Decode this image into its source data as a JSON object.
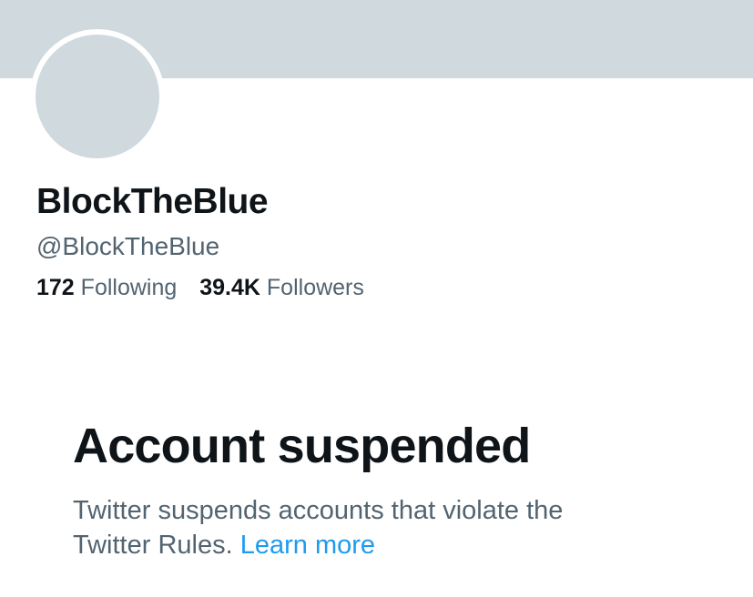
{
  "profile": {
    "display_name": "BlockTheBlue",
    "handle": "@BlockTheBlue",
    "following_count": "172",
    "following_label": "Following",
    "followers_count": "39.4K",
    "followers_label": "Followers"
  },
  "suspension": {
    "title": "Account suspended",
    "description_line1": "Twitter suspends accounts that violate the",
    "description_line2": "Twitter Rules.",
    "learn_more_label": "Learn more"
  },
  "colors": {
    "banner": "#cfd9de",
    "avatar": "#cfd9de",
    "text_primary": "#0f1419",
    "text_secondary": "#536471",
    "link": "#1d9bf0"
  }
}
